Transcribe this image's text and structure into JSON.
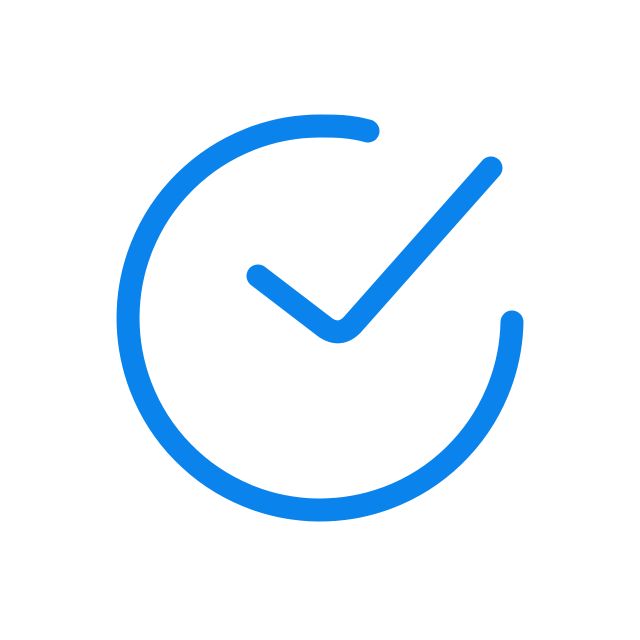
{
  "icon": {
    "name": "check-circle-icon",
    "color": "#0A84EC",
    "background": "#FFFFFF"
  }
}
